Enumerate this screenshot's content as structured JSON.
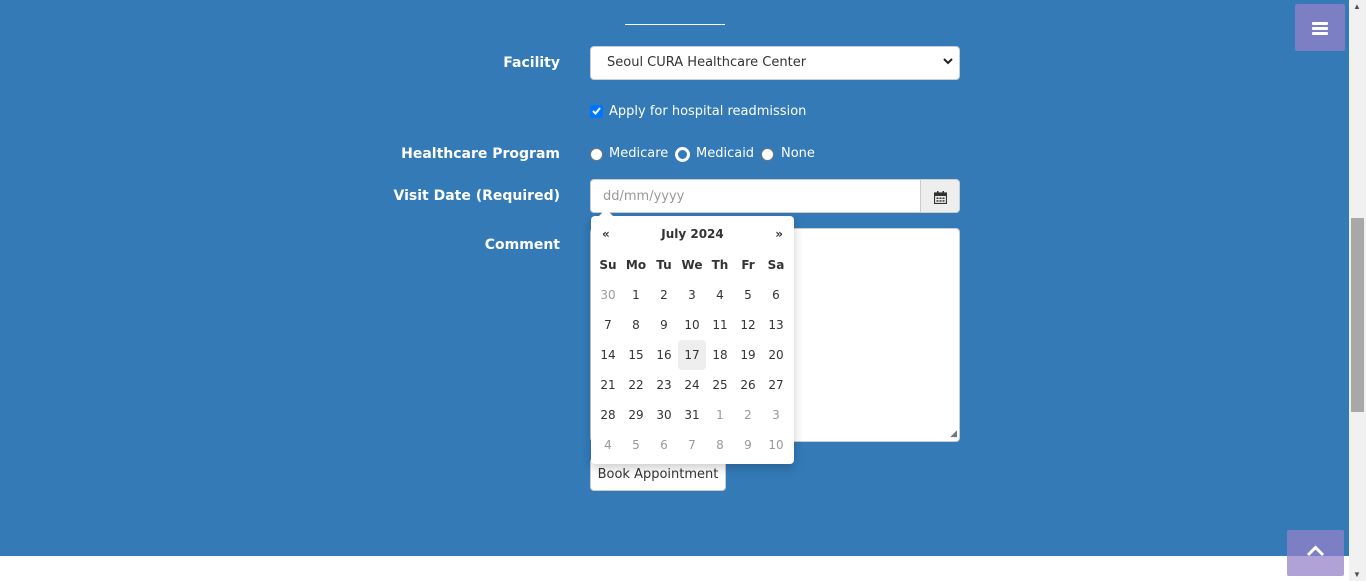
{
  "form": {
    "facility_label": "Facility",
    "facility_value": "Seoul CURA Healthcare Center",
    "readmission_label": "Apply for hospital readmission",
    "program_label": "Healthcare Program",
    "program_options": [
      "Medicare",
      "Medicaid",
      "None"
    ],
    "visit_date_label": "Visit Date (Required)",
    "visit_date_placeholder": "dd/mm/yyyy",
    "comment_label": "Comment",
    "book_button": "Book Appointment"
  },
  "datepicker": {
    "prev": "«",
    "next": "»",
    "month_year": "July 2024",
    "weekdays": [
      "Su",
      "Mo",
      "Tu",
      "We",
      "Th",
      "Fr",
      "Sa"
    ],
    "weeks": [
      [
        "30",
        "1",
        "2",
        "3",
        "4",
        "5",
        "6"
      ],
      [
        "7",
        "8",
        "9",
        "10",
        "11",
        "12",
        "13"
      ],
      [
        "14",
        "15",
        "16",
        "17",
        "18",
        "19",
        "20"
      ],
      [
        "21",
        "22",
        "23",
        "24",
        "25",
        "26",
        "27"
      ],
      [
        "28",
        "29",
        "30",
        "31",
        "1",
        "2",
        "3"
      ],
      [
        "4",
        "5",
        "6",
        "7",
        "8",
        "9",
        "10"
      ]
    ],
    "today": "17"
  },
  "icons": {
    "calendar": "calendar-icon",
    "menu": "hamburger-icon",
    "back_to_top": "chevron-up-icon"
  },
  "colors": {
    "section_bg": "#337ab7",
    "checkbox": "#0075ff",
    "toggle_bg": "#9682c8"
  }
}
